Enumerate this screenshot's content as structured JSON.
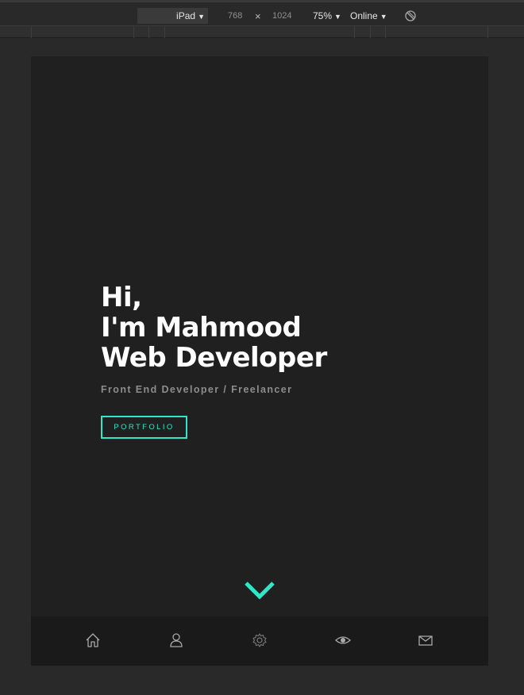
{
  "toolbar": {
    "device": "iPad",
    "width": "768",
    "times": "×",
    "height": "1024",
    "zoom": "75%",
    "network": "Online",
    "caret": "▼",
    "rotate_icon": "rotate-icon"
  },
  "hero": {
    "line1": "Hi,",
    "line2": "I'm Mahmood",
    "line3": "Web Developer",
    "subtitle": "Front End Developer / Freelancer",
    "button_label": "PORTFOLIO"
  },
  "nav": {
    "items": [
      {
        "icon": "home-icon"
      },
      {
        "icon": "user-icon"
      },
      {
        "icon": "gear-icon"
      },
      {
        "icon": "eye-icon"
      },
      {
        "icon": "mail-icon"
      }
    ]
  },
  "colors": {
    "accent": "#2ee8c9",
    "page_bg": "#202020",
    "nav_bg": "#1a1a1a"
  }
}
